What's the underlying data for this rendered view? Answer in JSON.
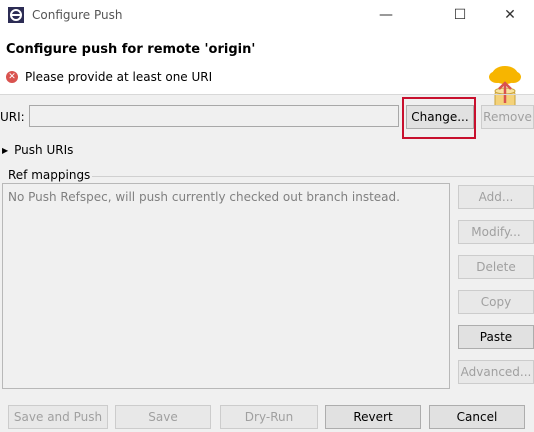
{
  "window": {
    "title": "Configure Push",
    "minimize_glyph": "—",
    "maximize_glyph": "☐",
    "close_glyph": "✕"
  },
  "header": {
    "title": "Configure push for remote 'origin'",
    "error_message": "Please provide at least one URI",
    "error_icon": "error-icon",
    "wizard_icon": "push-upload-icon"
  },
  "uri": {
    "label": "URI:",
    "value": "",
    "change_label": "Change...",
    "remove_label": "Remove"
  },
  "push_uris": {
    "label": "Push URIs"
  },
  "ref_mappings": {
    "label": "Ref mappings",
    "empty_text": "No Push Refspec, will push currently checked out branch instead.",
    "buttons": {
      "add": "Add...",
      "modify": "Modify...",
      "delete": "Delete",
      "copy": "Copy",
      "paste": "Paste",
      "advanced": "Advanced..."
    }
  },
  "footer": {
    "save_and_push": "Save and Push",
    "save": "Save",
    "dry_run": "Dry-Run",
    "revert": "Revert",
    "cancel": "Cancel"
  },
  "colors": {
    "highlight": "#c8102e",
    "error": "#d9534f",
    "accent_cloud": "#f7b500"
  }
}
